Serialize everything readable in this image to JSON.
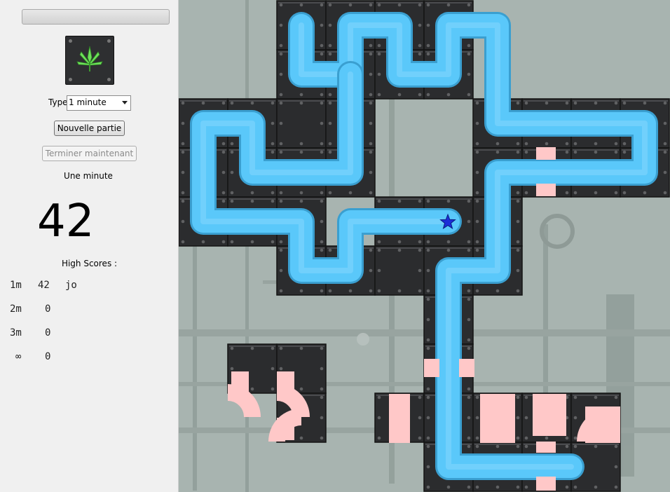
{
  "sidebar": {
    "progress_fraction": 0.0,
    "logo_icon": "cannabis-leaf-icon",
    "type_label": "Type",
    "type_select_value": "1 minute",
    "new_game_label": "Nouvelle partie",
    "finish_now_label": "Terminer maintenant",
    "mode_label": "Une minute",
    "timer_value": "42",
    "high_scores_title": "High Scores :",
    "high_scores": [
      {
        "mode": "1m",
        "score": "42",
        "name": "jo"
      },
      {
        "mode": "2m",
        "score": "0",
        "name": ""
      },
      {
        "mode": "3m",
        "score": "0",
        "name": ""
      },
      {
        "mode": "∞",
        "score": "0",
        "name": ""
      }
    ]
  },
  "board": {
    "colors": {
      "tile": "#2b2c2e",
      "tile_edge": "#141414",
      "water": "#5ac8fa",
      "water_highlight": "#8ed9ff",
      "empty_pipe": "#ffc8c8",
      "star": "#1c2fd8",
      "background": "#a8b4b0"
    },
    "source_icon": "star-icon"
  }
}
